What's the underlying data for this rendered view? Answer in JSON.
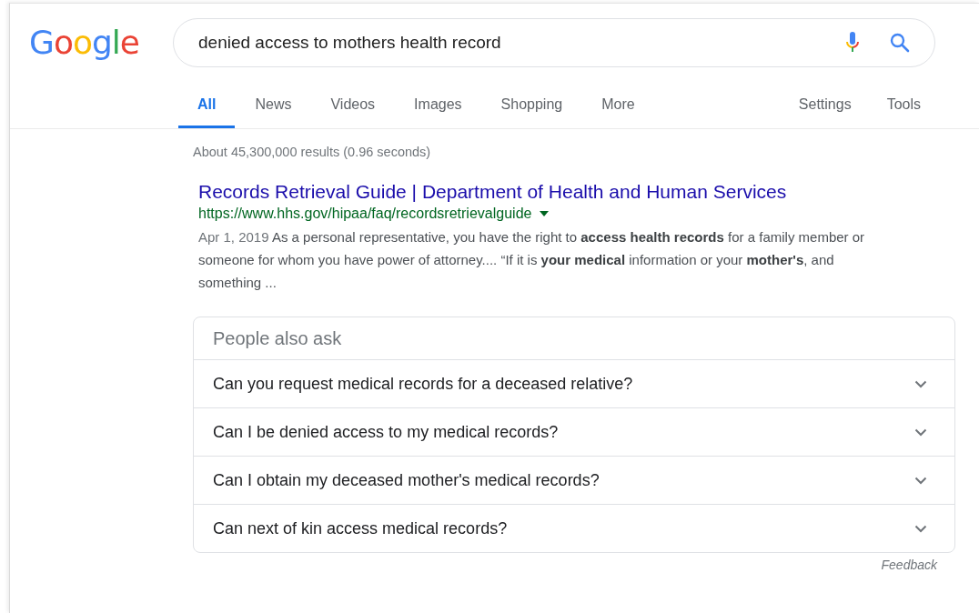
{
  "logo": {
    "text": "Google"
  },
  "search": {
    "value": "denied access to mothers health record"
  },
  "tabs": [
    {
      "label": "All",
      "selected": true
    },
    {
      "label": "News",
      "selected": false
    },
    {
      "label": "Videos",
      "selected": false
    },
    {
      "label": "Images",
      "selected": false
    },
    {
      "label": "Shopping",
      "selected": false
    },
    {
      "label": "More",
      "selected": false
    }
  ],
  "tools": [
    "Settings",
    "Tools"
  ],
  "result_stats": "About 45,300,000 results (0.96 seconds)",
  "result": {
    "title": "Records Retrieval Guide | Department of Health and Human Services",
    "url": "https://www.hhs.gov/hipaa/faq/recordsretrievalguide",
    "date": "Apr 1, 2019",
    "snippet": "As a personal representative, you have the right to **access health records** for a family member or someone for whom you have power of attorney.... “If it is **your medical** information or your **mother's**, and something ..."
  },
  "people_also_ask": {
    "heading": "People also ask",
    "questions": [
      {
        "text": "Can you request medical records for a deceased relative?",
        "expanded": false
      },
      {
        "text": "Can I be denied access to my medical records?",
        "expanded": false
      },
      {
        "text": "Can I obtain my deceased mother's medical records?",
        "expanded": false
      },
      {
        "text": "Can next of kin access medical records?",
        "expanded": false
      }
    ]
  },
  "feedback": "Feedback"
}
